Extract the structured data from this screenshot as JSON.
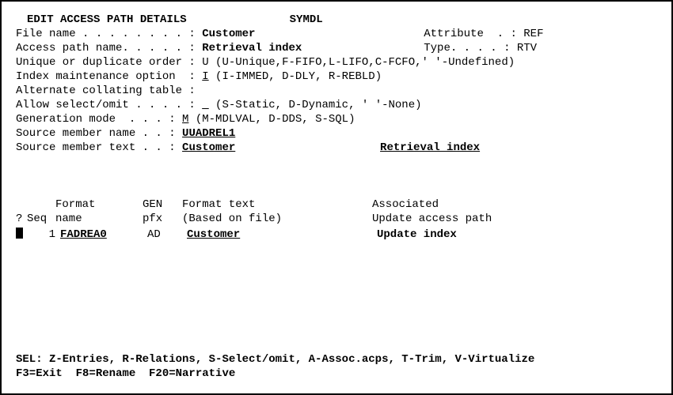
{
  "header": {
    "title": "EDIT ACCESS PATH DETAILS",
    "system": "SYMDL"
  },
  "fields": {
    "file_name": {
      "label": "File name . . . . . . . . : ",
      "value": "Customer"
    },
    "attribute": {
      "label": "Attribute  . : ",
      "value": "REF"
    },
    "access_path": {
      "label": "Access path name. . . . . : ",
      "value": "Retrieval index"
    },
    "type": {
      "label": "Type. . . . : ",
      "value": "RTV"
    },
    "unique_dup": {
      "label": "Unique or duplicate order : ",
      "value": "U",
      "hint": " (U-Unique,F-FIFO,L-LIFO,C-FCFO,' '-Undefined)"
    },
    "index_maint": {
      "label": "Index maintenance option  : ",
      "value": "I",
      "hint": " (I-IMMED, D-DLY, R-REBLD)"
    },
    "alt_collate": {
      "label": "Alternate collating table :",
      "value": ""
    },
    "allow_select": {
      "label": "Allow select/omit . . . . : ",
      "value": "_",
      "hint": " (S-Static, D-Dynamic, ' '-None)"
    },
    "gen_mode": {
      "label": "Generation mode  . . . : ",
      "value": "M",
      "hint": " (M-MDLVAL, D-DDS, S-SQL)"
    },
    "src_name": {
      "label": "Source member name . . : ",
      "value": "UUADREL1"
    },
    "src_text": {
      "label": "Source member text . . : ",
      "value1": "Customer",
      "value2": "Retrieval index"
    }
  },
  "table": {
    "hdr_q": "?",
    "hdr_seq": "Seq",
    "hdr_format": "Format",
    "hdr_name": "name",
    "hdr_gen": "GEN",
    "hdr_pfx": "pfx",
    "hdr_fmttext": "Format text",
    "hdr_basedon": "(Based on file)",
    "hdr_assoc": "Associated",
    "hdr_updpath": "Update access path",
    "row1": {
      "seq": "1",
      "name": "FADREA0",
      "pfx": "AD",
      "fmttext": "Customer",
      "assoc": "Update index"
    }
  },
  "footer": {
    "sel": "SEL: Z-Entries, R-Relations, S-Select/omit, A-Assoc.acps, T-Trim, V-Virtualize",
    "fkeys": "F3=Exit  F8=Rename  F20=Narrative"
  }
}
